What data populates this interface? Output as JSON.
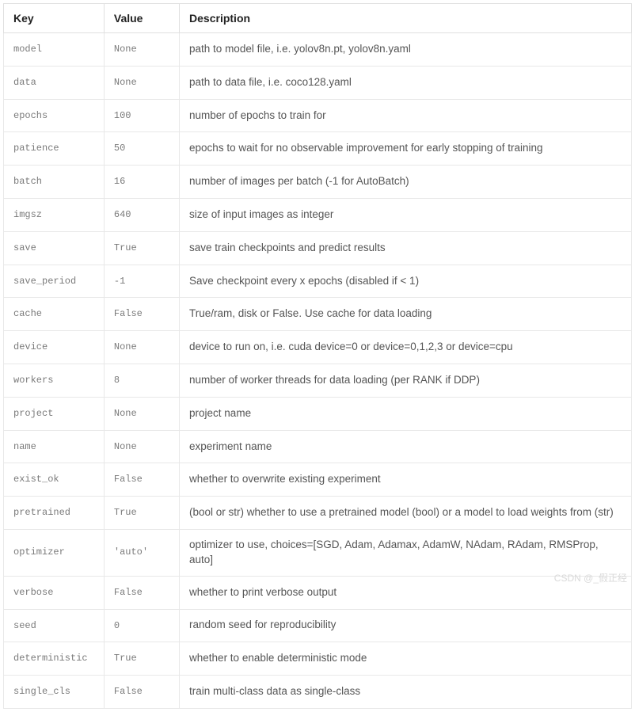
{
  "headers": {
    "key": "Key",
    "value": "Value",
    "description": "Description"
  },
  "rows": [
    {
      "key": "model",
      "value": "None",
      "description": "path to model file, i.e. yolov8n.pt, yolov8n.yaml"
    },
    {
      "key": "data",
      "value": "None",
      "description": "path to data file, i.e. coco128.yaml"
    },
    {
      "key": "epochs",
      "value": "100",
      "description": "number of epochs to train for"
    },
    {
      "key": "patience",
      "value": "50",
      "description": "epochs to wait for no observable improvement for early stopping of training"
    },
    {
      "key": "batch",
      "value": "16",
      "description": "number of images per batch (-1 for AutoBatch)"
    },
    {
      "key": "imgsz",
      "value": "640",
      "description": "size of input images as integer"
    },
    {
      "key": "save",
      "value": "True",
      "description": "save train checkpoints and predict results"
    },
    {
      "key": "save_period",
      "value": "-1",
      "description": "Save checkpoint every x epochs (disabled if < 1)"
    },
    {
      "key": "cache",
      "value": "False",
      "description": "True/ram, disk or False. Use cache for data loading"
    },
    {
      "key": "device",
      "value": "None",
      "description": "device to run on, i.e. cuda device=0 or device=0,1,2,3 or device=cpu"
    },
    {
      "key": "workers",
      "value": "8",
      "description": "number of worker threads for data loading (per RANK if DDP)"
    },
    {
      "key": "project",
      "value": "None",
      "description": "project name"
    },
    {
      "key": "name",
      "value": "None",
      "description": "experiment name"
    },
    {
      "key": "exist_ok",
      "value": "False",
      "description": "whether to overwrite existing experiment"
    },
    {
      "key": "pretrained",
      "value": "True",
      "description": "(bool or str) whether to use a pretrained model (bool) or a model to load weights from (str)"
    },
    {
      "key": "optimizer",
      "value": "'auto'",
      "description": "optimizer to use, choices=[SGD, Adam, Adamax, AdamW, NAdam, RAdam, RMSProp, auto]"
    },
    {
      "key": "verbose",
      "value": "False",
      "description": "whether to print verbose output"
    },
    {
      "key": "seed",
      "value": "0",
      "description": "random seed for reproducibility"
    },
    {
      "key": "deterministic",
      "value": "True",
      "description": "whether to enable deterministic mode"
    },
    {
      "key": "single_cls",
      "value": "False",
      "description": "train multi-class data as single-class"
    }
  ],
  "watermark": "CSDN @_假正经"
}
